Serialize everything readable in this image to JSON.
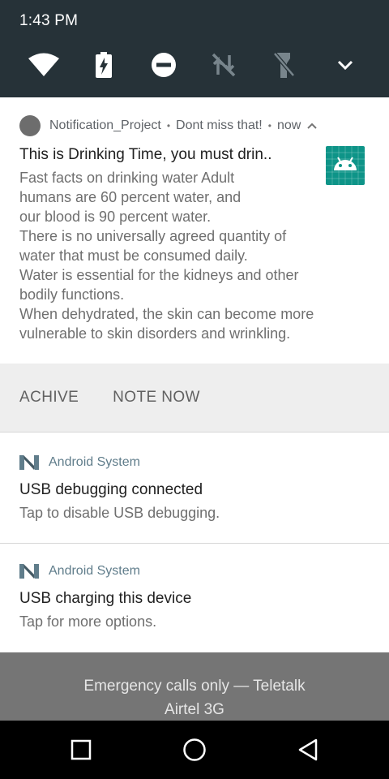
{
  "status": {
    "time": "1:43 PM"
  },
  "quick_settings": {
    "tiles": [
      {
        "icon": "wifi-icon"
      },
      {
        "icon": "battery-saver-icon"
      },
      {
        "icon": "do-not-disturb-icon"
      },
      {
        "icon": "mobile-data-off-icon"
      },
      {
        "icon": "flashlight-off-icon"
      },
      {
        "icon": "expand-chevron-icon"
      }
    ]
  },
  "notification_main": {
    "app_name": "Notification_Project",
    "separator": "•",
    "subtext": "Dont miss that!",
    "time": "now",
    "title": "This is Drinking Time, you must drin..",
    "body": "Fast facts on drinking water Adult\nhumans are 60 percent water, and\nour blood is 90 percent water.\n There is no universally agreed quantity of\nwater that must be consumed daily.\n Water is essential for the kidneys and other\nbodily functions.\n When dehydrated, the skin can become more\nvulnerable to skin disorders and wrinkling.",
    "large_icon": "android-robot-icon",
    "icon_color": "#0e9488",
    "actions": [
      {
        "label": "ACHIVE"
      },
      {
        "label": "NOTE NOW"
      }
    ]
  },
  "system_notifications": [
    {
      "app_name": "Android System",
      "title": "USB debugging connected",
      "text": "Tap to disable USB debugging."
    },
    {
      "app_name": "Android System",
      "title": "USB charging this device",
      "text": "Tap for more options."
    }
  ],
  "carrier": {
    "line1": "Emergency calls only — Teletalk",
    "line2": "Airtel 3G"
  },
  "navbar": {
    "buttons": [
      "recents-icon",
      "home-icon",
      "back-icon"
    ]
  },
  "colors": {
    "header_bg": "#263238",
    "system_app_accent": "#607d8b",
    "actions_bg": "#eeeeee"
  }
}
